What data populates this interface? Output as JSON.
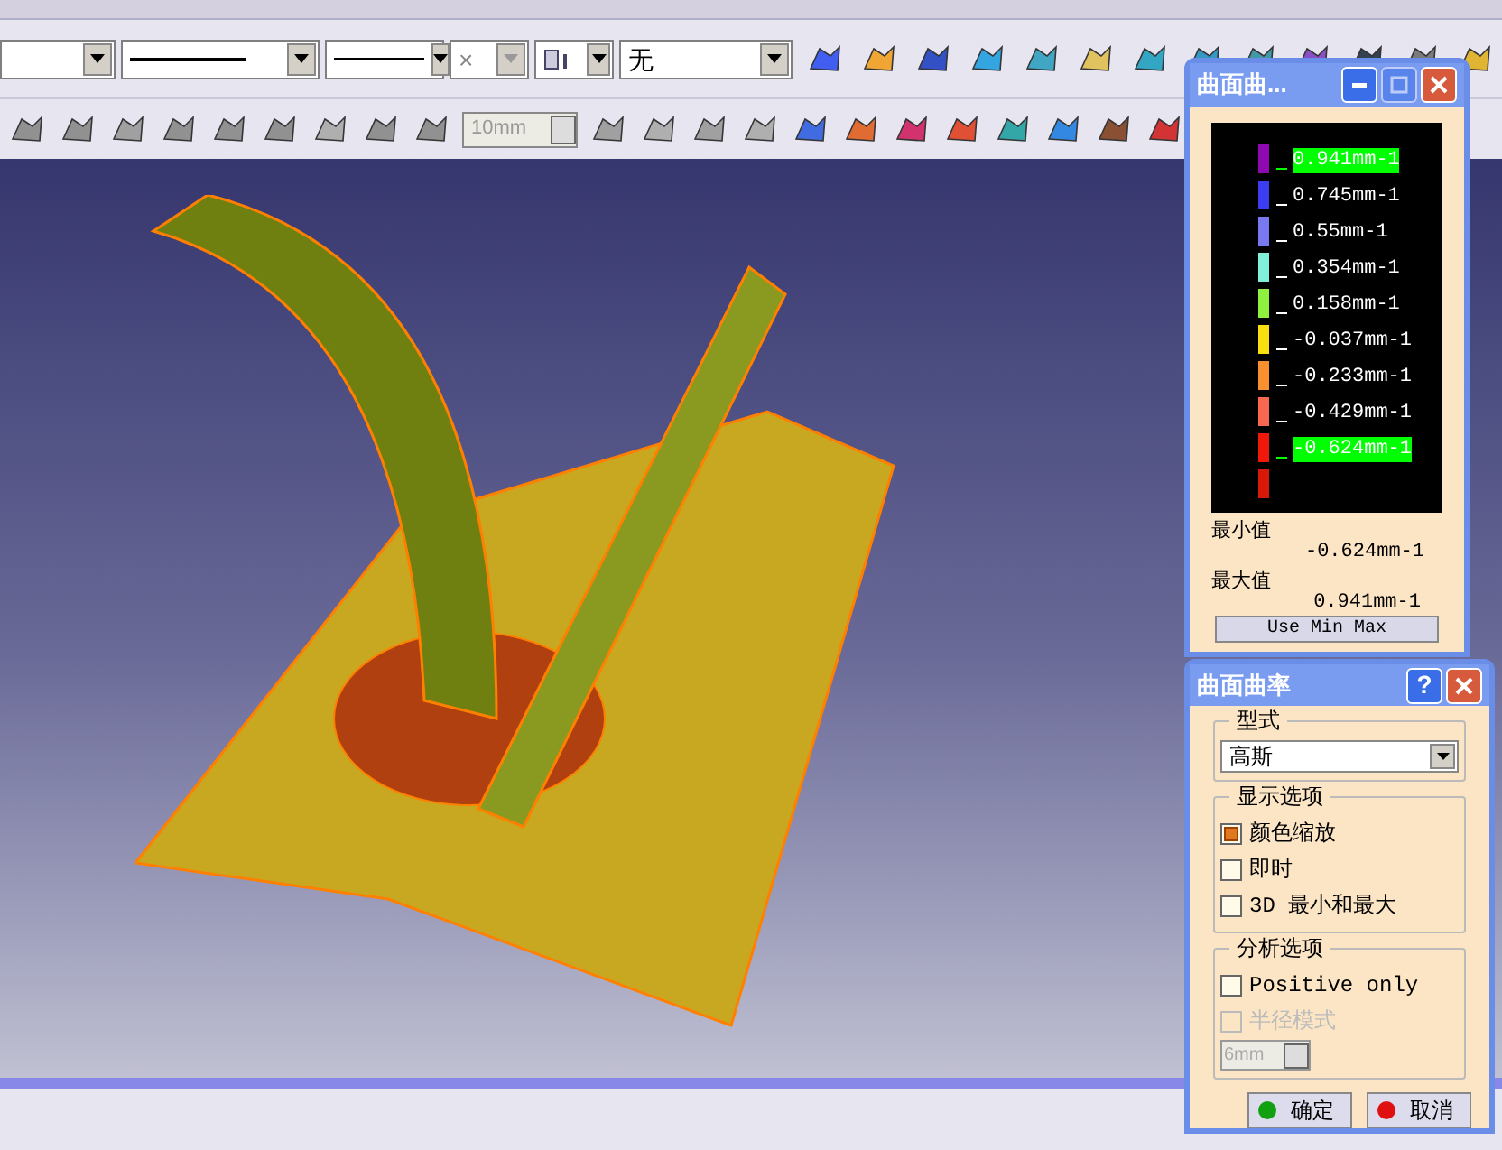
{
  "toolbar": {
    "combos": [
      {
        "kind": "blank"
      },
      {
        "kind": "thick-line"
      },
      {
        "kind": "thin-line"
      },
      {
        "kind": "text",
        "value": "×",
        "disabled": true
      },
      {
        "kind": "icon"
      },
      {
        "kind": "text",
        "value": "无",
        "disabled": false
      }
    ],
    "step_field": {
      "value": "10mm",
      "disabled": true
    }
  },
  "curvature_legend_window": {
    "title": "曲面曲...",
    "legend": [
      {
        "label": "0.941mm-1",
        "color": "#8e0ab0",
        "highlighted": true
      },
      {
        "label": "0.745mm-1",
        "color": "#3c3cf0",
        "highlighted": false
      },
      {
        "label": "0.55mm-1",
        "color": "#7878f0",
        "highlighted": false
      },
      {
        "label": "0.354mm-1",
        "color": "#80f0d8",
        "highlighted": false
      },
      {
        "label": "0.158mm-1",
        "color": "#90f040",
        "highlighted": false
      },
      {
        "label": "-0.037mm-1",
        "color": "#f8e010",
        "highlighted": false
      },
      {
        "label": "-0.233mm-1",
        "color": "#f89030",
        "highlighted": false
      },
      {
        "label": "-0.429mm-1",
        "color": "#f86850",
        "highlighted": false
      },
      {
        "label": "-0.624mm-1",
        "color": "#f01808",
        "highlighted": true
      },
      {
        "color": "#d81808"
      }
    ],
    "min_label": "最小值",
    "min_value": "-0.624mm-1",
    "max_label": "最大值",
    "max_value": "0.941mm-1",
    "button": "Use Min Max"
  },
  "surface_curvature_dialog": {
    "title": "曲面曲率",
    "help": "?",
    "type_group": {
      "title": "型式",
      "value": "高斯"
    },
    "display_group": {
      "title": "显示选项",
      "options": [
        {
          "label": "颜色缩放",
          "checked": true,
          "disabled": false
        },
        {
          "label": "即时",
          "checked": false,
          "disabled": false
        },
        {
          "label": "3D 最小和最大",
          "checked": false,
          "disabled": false
        }
      ]
    },
    "analysis_group": {
      "title": "分析选项",
      "options": [
        {
          "label": "Positive only",
          "checked": false,
          "disabled": false
        },
        {
          "label": "半径模式",
          "checked": false,
          "disabled": true
        }
      ],
      "radius_field": {
        "value": "6mm",
        "disabled": true
      }
    },
    "buttons": [
      {
        "label": "确定",
        "color": "#10a010"
      },
      {
        "label": "取消",
        "color": "#e01010"
      }
    ]
  }
}
